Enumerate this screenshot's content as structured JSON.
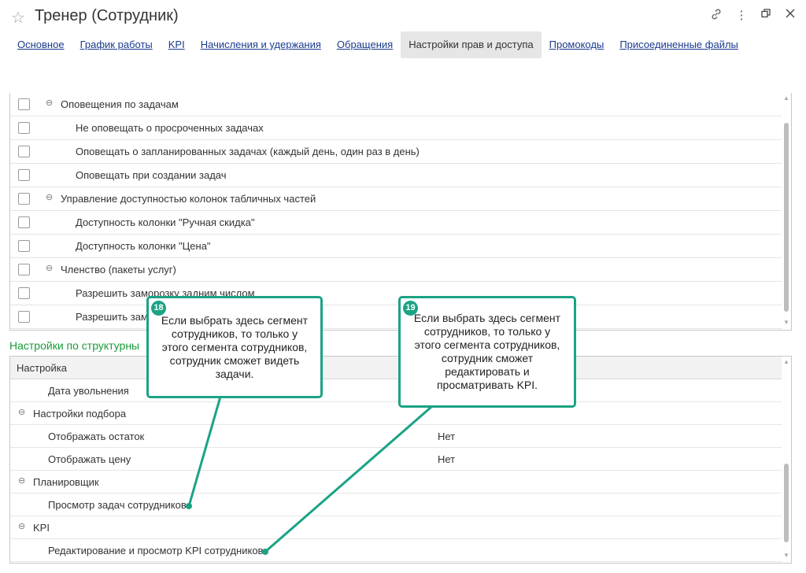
{
  "window": {
    "title": "Тренер (Сотрудник)",
    "icons": [
      "star-icon",
      "link-icon",
      "more-icon",
      "restore-icon",
      "close-icon"
    ]
  },
  "tabs": [
    {
      "label": "Основное",
      "active": false
    },
    {
      "label": "График работы",
      "active": false
    },
    {
      "label": "KPI",
      "active": false
    },
    {
      "label": "Начисления и удержания",
      "active": false
    },
    {
      "label": "Обращения",
      "active": false
    },
    {
      "label": "Настройки прав и доступа",
      "active": true
    },
    {
      "label": "Промокоды",
      "active": false
    },
    {
      "label": "Присоединенные файлы",
      "active": false
    }
  ],
  "rights_tree": [
    {
      "label": "Оповещения по задачам",
      "group": true
    },
    {
      "label": "Не оповещать о просроченных задачах",
      "group": false
    },
    {
      "label": "Оповещать о запланированных задачах (каждый день, один раз в день)",
      "group": false
    },
    {
      "label": "Оповещать при создании задач",
      "group": false
    },
    {
      "label": "Управление доступностью колонок табличных частей",
      "group": true
    },
    {
      "label": "Доступность колонки \"Ручная скидка\"",
      "group": false
    },
    {
      "label": "Доступность колонки \"Цена\"",
      "group": false
    },
    {
      "label": "Членство (пакеты услуг)",
      "group": true
    },
    {
      "label": "Разрешить заморозку задним числом",
      "group": false
    },
    {
      "label": "Разрешить зам",
      "group": false
    }
  ],
  "structural_section": {
    "title": "Настройки по структурны",
    "column_header": "Настройка",
    "rows": [
      {
        "label": "Дата увольнения",
        "value": "",
        "group": false
      },
      {
        "label": "Настройки подбора",
        "value": "",
        "group": true
      },
      {
        "label": "Отображать остаток",
        "value": "Нет",
        "group": false
      },
      {
        "label": "Отображать цену",
        "value": "Нет",
        "group": false
      },
      {
        "label": "Планировщик",
        "value": "",
        "group": true
      },
      {
        "label": "Просмотр задач сотрудников",
        "value": "",
        "group": false
      },
      {
        "label": "KPI",
        "value": "",
        "group": true
      },
      {
        "label": "Редактирование и просмотр KPI сотрудников",
        "value": "",
        "group": false
      }
    ]
  },
  "callouts": [
    {
      "number": "18",
      "text": "Если выбрать здесь сегмент сотрудников, то только у этого сегмента сотрудников, сотрудник сможет видеть задачи."
    },
    {
      "number": "19",
      "text": "Если выбрать здесь сегмент сотрудников, то только у этого сегмента сотрудников, сотрудник сможет редактировать и просматривать KPI."
    }
  ],
  "colors": {
    "accent": "#1aa384",
    "link": "#1a3b8f",
    "section_title": "#1a9a3a"
  }
}
